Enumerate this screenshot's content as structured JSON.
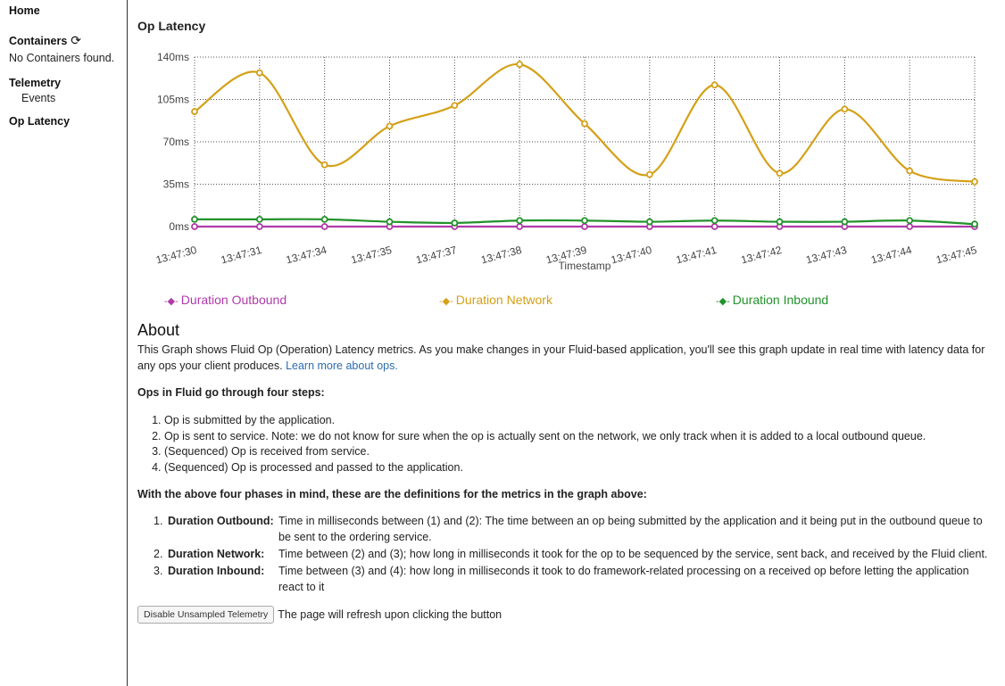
{
  "sidebar": {
    "home": "Home",
    "containers": "Containers",
    "containers_empty": "No Containers found.",
    "telemetry": "Telemetry",
    "events": "Events",
    "op_latency": "Op Latency"
  },
  "main": {
    "title": "Op Latency",
    "about_title": "About",
    "about_text": "This Graph shows Fluid Op (Operation) Latency metrics. As you make changes in your Fluid-based application, you'll see this graph update in real time with latency data for any ops your client produces. ",
    "about_link": "Learn more about ops.",
    "steps_heading": "Ops in Fluid go through four steps:",
    "steps": [
      "Op is submitted by the application.",
      "Op is sent to service. Note: we do not know for sure when the op is actually sent on the network, we only track when it is added to a local outbound queue.",
      "(Sequenced) Op is received from service.",
      "(Sequenced) Op is processed and passed to the application."
    ],
    "defs_heading": "With the above four phases in mind, these are the definitions for the metrics in the graph above:",
    "definitions": [
      {
        "num": "1.",
        "term": "Duration Outbound:",
        "desc": "Time in milliseconds between (1) and (2): The time between an op being submitted by the application and it being put in the outbound queue to be sent to the ordering service."
      },
      {
        "num": "2.",
        "term": "Duration Network:",
        "desc": "Time between (2) and (3); how long in milliseconds it took for the op to be sequenced by the service, sent back, and received by the Fluid client."
      },
      {
        "num": "3.",
        "term": "Duration Inbound:",
        "desc": "Time between (3) and (4): how long in milliseconds it took to do framework-related processing on a received op before letting the application react to it"
      }
    ],
    "button_label": "Disable Unsampled Telemetry",
    "button_note": "The page will refresh upon clicking the button"
  },
  "icons": {
    "refresh": "refresh-icon"
  },
  "chart_data": {
    "type": "line",
    "title": "Op Latency",
    "xlabel": "Timestamp",
    "ylabel": "",
    "categories": [
      "13:47:30",
      "13:47:31",
      "13:47:34",
      "13:47:35",
      "13:47:37",
      "13:47:38",
      "13:47:39",
      "13:47:40",
      "13:47:41",
      "13:47:42",
      "13:47:43",
      "13:47:44",
      "13:47:45"
    ],
    "yticks": [
      "0ms",
      "35ms",
      "70ms",
      "105ms",
      "140ms"
    ],
    "ylim": [
      0,
      140
    ],
    "grid": true,
    "legend": "bottom",
    "series": [
      {
        "name": "Duration Outbound",
        "color": "#b03aaa",
        "values": [
          0,
          0,
          0,
          0,
          0,
          0,
          0,
          0,
          0,
          0,
          0,
          0,
          0
        ]
      },
      {
        "name": "Duration Network",
        "color": "#d4a017",
        "values": [
          95,
          127,
          51,
          83,
          100,
          134,
          85,
          43,
          117,
          44,
          97,
          46,
          37
        ]
      },
      {
        "name": "Duration Inbound",
        "color": "#22922b",
        "values": [
          6,
          6,
          6,
          4,
          3,
          5,
          5,
          4,
          5,
          4,
          4,
          5,
          2
        ]
      }
    ]
  }
}
